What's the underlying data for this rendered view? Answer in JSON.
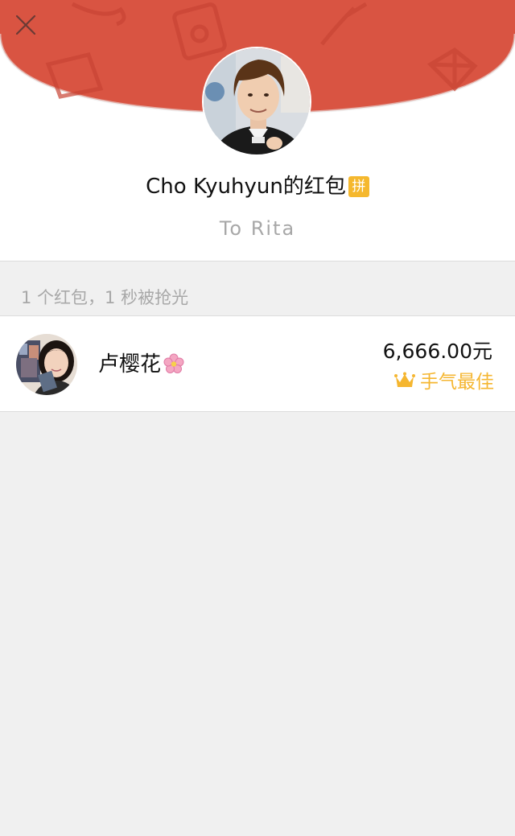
{
  "header": {
    "close_icon": "close-icon",
    "accent_color": "#d95442"
  },
  "sender": {
    "name": "Cho Kyuhyun",
    "suffix": "的红包",
    "badge": "拼",
    "greeting": "To Rita"
  },
  "summary": {
    "text": "1 个红包，1 秒被抢光"
  },
  "recipients": [
    {
      "name": "卢樱花",
      "emoji": "cherry-blossom-icon",
      "amount": "6,666.00元",
      "tag": "手气最佳",
      "tag_icon": "crown-icon",
      "tag_color": "#f5b630"
    }
  ]
}
